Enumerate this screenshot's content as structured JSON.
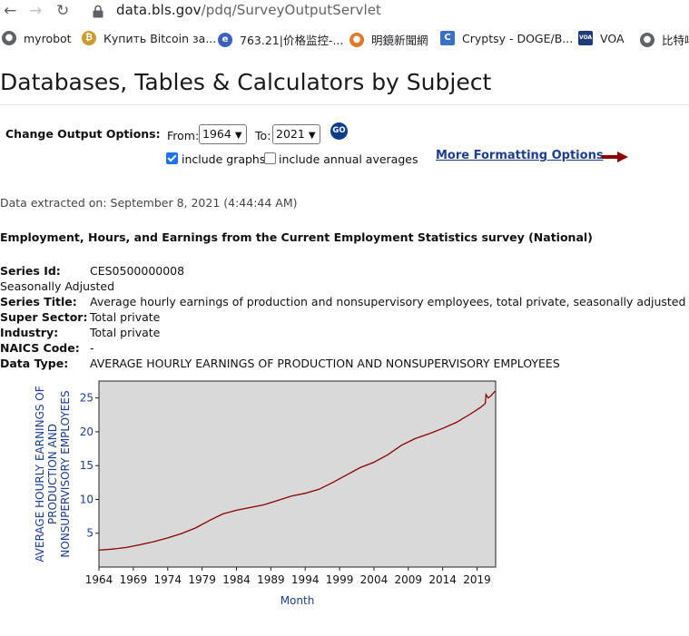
{
  "browser": {
    "url_host": "data.bls.gov",
    "url_path": "/pdq/SurveyOutputServlet",
    "bookmarks": [
      {
        "label": "myrobot",
        "icon": "globe-icon"
      },
      {
        "label": "Купить Bitcoin за...",
        "icon": "bitcoin-icon"
      },
      {
        "label": "763.21|价格监控-...",
        "icon": "eye-icon"
      },
      {
        "label": "明鏡新聞網",
        "icon": "mirror-icon"
      },
      {
        "label": "Cryptsy - DOGE/B...",
        "icon": "cryptsy-icon"
      },
      {
        "label": "VOA",
        "icon": "voa-icon"
      },
      {
        "label": "比特啡",
        "icon": "globe-icon"
      }
    ]
  },
  "page": {
    "title": "Databases, Tables & Calculators by Subject",
    "change_output_label": "Change Output Options:",
    "from_label": "From:",
    "from_value": "1964",
    "to_label": "To:",
    "to_value": "2021",
    "go_label": "GO",
    "include_graphs_label": "include graphs",
    "include_graphs_checked": true,
    "include_annual_label": "include annual averages",
    "include_annual_checked": false,
    "more_formatting_label": "More Formatting Options",
    "extracted": "Data extracted on: September 8, 2021 (4:44:44 AM)",
    "survey_title": "Employment, Hours, and Earnings from the Current Employment Statistics survey (National)"
  },
  "series": {
    "id_label": "Series Id:",
    "id_value": "CES0500000008",
    "adjustment": "Seasonally Adjusted",
    "title_label": "Series Title:",
    "title_value": "Average hourly earnings of production and nonsupervisory employees, total private, seasonally adjusted",
    "super_sector_label": "Super Sector:",
    "super_sector_value": "Total private",
    "industry_label": "Industry:",
    "industry_value": "Total private",
    "naics_label": "NAICS Code:",
    "naics_value": "-",
    "data_type_label": "Data Type:",
    "data_type_value": "AVERAGE HOURLY EARNINGS OF PRODUCTION AND NONSUPERVISORY EMPLOYEES"
  },
  "colors": {
    "line": "#8b0000",
    "plot_bg": "#d9d9d9",
    "axis_text": "#1d3d8f",
    "link": "#1d3d8f",
    "arrow": "#8b0000"
  },
  "chart_data": {
    "type": "line",
    "xlabel": "Month",
    "ylabel_lines": [
      "AVERAGE HOURLY EARNINGS OF",
      "PRODUCTION AND",
      "NONSUPERVISORY EMPLOYEES"
    ],
    "x_ticks": [
      "1964",
      "1969",
      "1974",
      "1979",
      "1984",
      "1989",
      "1994",
      "1999",
      "2004",
      "2009",
      "2014",
      "2019"
    ],
    "y_ticks": [
      5,
      10,
      15,
      20,
      25
    ],
    "xlim": [
      1964,
      2021.7
    ],
    "ylim": [
      0,
      27.5
    ],
    "grid": false,
    "series": [
      {
        "x": [
          1964,
          1966,
          1968,
          1970,
          1972,
          1974,
          1976,
          1978,
          1980,
          1982,
          1984,
          1986,
          1988,
          1990,
          1992,
          1994,
          1996,
          1998,
          2000,
          2002,
          2004,
          2006,
          2008,
          2010,
          2012,
          2014,
          2016,
          2018,
          2019.5,
          2020.2,
          2020.3,
          2020.6,
          2021,
          2021.6
        ],
        "y": [
          2.5,
          2.65,
          2.9,
          3.3,
          3.75,
          4.3,
          4.95,
          5.75,
          6.85,
          7.85,
          8.4,
          8.8,
          9.2,
          9.85,
          10.5,
          10.9,
          11.5,
          12.5,
          13.6,
          14.7,
          15.5,
          16.6,
          18.0,
          19.0,
          19.7,
          20.5,
          21.4,
          22.6,
          23.6,
          24.2,
          25.5,
          25.0,
          25.3,
          26.0
        ]
      }
    ]
  }
}
